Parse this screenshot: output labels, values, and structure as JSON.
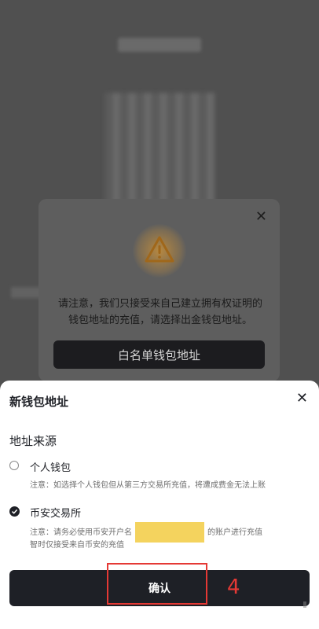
{
  "warning_dialog": {
    "icon": "warning-triangle-icon",
    "close_icon": "close-icon",
    "message": "请注意，我们只接受来自己建立拥有权证明的钱包地址的充值，请选择出金钱包地址。",
    "button_label": "白名单钱包地址",
    "accent_color": "#f0b90b"
  },
  "sheet": {
    "title": "新钱包地址",
    "close_icon": "close-icon",
    "section_label": "地址来源",
    "options": [
      {
        "label": "个人钱包",
        "selected": false,
        "note": "注意：如选择个人钱包但从第三方交易所充值，将遭成费金无法上账"
      },
      {
        "label": "币安交易所",
        "selected": true,
        "note_prefix": "注意：请务必使用币安开户名",
        "note_suffix": "的账户进行充值",
        "note_line2": "智时仅接受来自币安的充值"
      }
    ],
    "confirm_label": "确认"
  },
  "annotation": {
    "number": "4",
    "color": "#e53935"
  }
}
